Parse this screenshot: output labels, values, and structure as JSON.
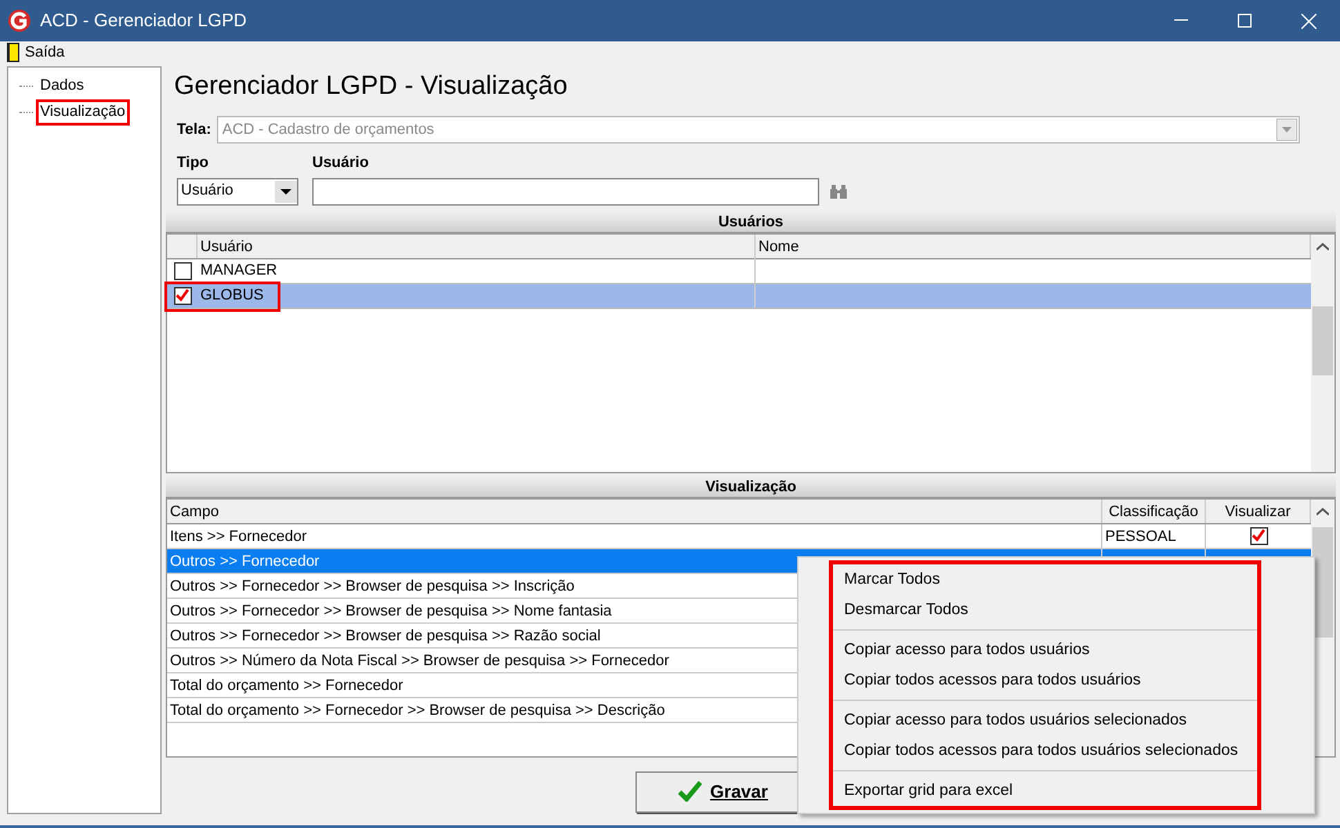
{
  "window": {
    "title": "ACD - Gerenciador LGPD"
  },
  "menu": [
    {
      "label": "Saída"
    }
  ],
  "tree": [
    {
      "label": "Dados",
      "highlighted": false
    },
    {
      "label": "Visualização",
      "highlighted": true
    }
  ],
  "heading": "Gerenciador LGPD - Visualização",
  "tela": {
    "label": "Tela:",
    "value": "ACD - Cadastro de orçamentos",
    "disabled": true
  },
  "tipo": {
    "label": "Tipo",
    "value": "Usuário"
  },
  "usuario": {
    "label": "Usuário"
  },
  "users": {
    "title": "Usuários",
    "columns": [
      "Usuário",
      "Nome"
    ],
    "rows": [
      {
        "usuario": "MANAGER",
        "checked": false,
        "selected": false,
        "highlighted": false
      },
      {
        "usuario": "GLOBUS",
        "checked": true,
        "selected": true,
        "highlighted": true
      }
    ]
  },
  "fields": {
    "title": "Visualização",
    "columns": [
      "Campo",
      "Classificação",
      "Visualizar"
    ],
    "rows": [
      {
        "campo": "Itens >> Fornecedor",
        "classificacao": "PESSOAL",
        "visualizar": true,
        "selected": false
      },
      {
        "campo": "Outros >> Fornecedor",
        "selected": true
      },
      {
        "campo": "Outros >> Fornecedor >> Browser de pesquisa >> Inscrição",
        "selected": false
      },
      {
        "campo": "Outros >> Fornecedor >> Browser de pesquisa >> Nome fantasia",
        "selected": false
      },
      {
        "campo": "Outros >> Fornecedor >> Browser de pesquisa >> Razão social",
        "selected": false
      },
      {
        "campo": "Outros >> Número da Nota Fiscal >> Browser de pesquisa >> Fornecedor",
        "selected": false
      },
      {
        "campo": "Total do orçamento >> Fornecedor",
        "selected": false
      },
      {
        "campo": "Total do orçamento >> Fornecedor >> Browser de pesquisa >> Descrição",
        "selected": false
      }
    ]
  },
  "context_menu": {
    "highlighted": true,
    "items": [
      {
        "kind": "item",
        "label": "Marcar Todos"
      },
      {
        "kind": "item",
        "label": "Desmarcar Todos"
      },
      {
        "kind": "separator"
      },
      {
        "kind": "item",
        "label": "Copiar acesso para todos usuários"
      },
      {
        "kind": "item",
        "label": "Copiar todos acessos para todos usuários"
      },
      {
        "kind": "separator"
      },
      {
        "kind": "item",
        "label": "Copiar acesso para todos usuários selecionados"
      },
      {
        "kind": "item",
        "label": "Copiar todos acessos para todos usuários selecionados"
      },
      {
        "kind": "separator"
      },
      {
        "kind": "item",
        "label": "Exportar grid para excel"
      }
    ]
  },
  "save_button": {
    "label": "Gravar"
  }
}
